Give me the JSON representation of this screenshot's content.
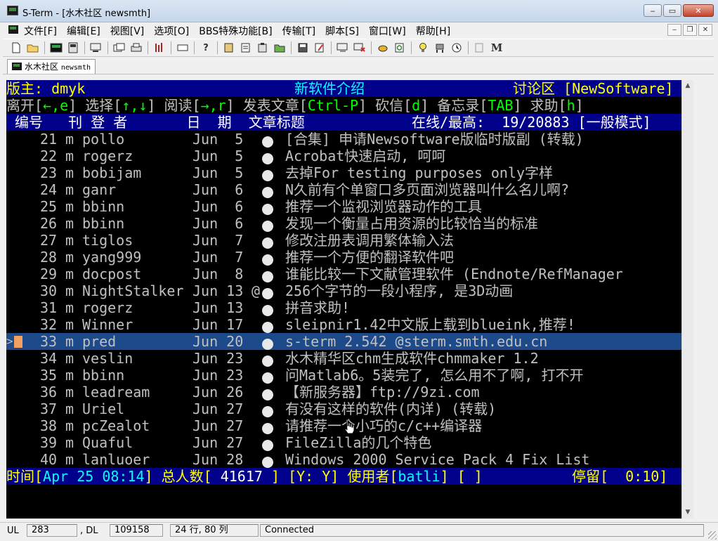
{
  "window": {
    "title": "S-Term - [水木社区 newsmth]",
    "minimize": "‒",
    "restore": "▭",
    "close": "✕"
  },
  "menu": {
    "items": [
      "文件[F]",
      "编辑[E]",
      "视图[V]",
      "选项[O]",
      "BBS特殊功能[B]",
      "传输[T]",
      "脚本[S]",
      "窗口[W]",
      "帮助[H]"
    ],
    "mdi_minimize": "‒",
    "mdi_restore": "❐",
    "mdi_close": "✕"
  },
  "tab": {
    "label": "水木社区",
    "host": "newsmth"
  },
  "terminal": {
    "header": {
      "moderator": "版主: dmyk",
      "board_title": "新软件介绍",
      "board_name": "讨论区 [NewSoftware]"
    },
    "help_line": {
      "leave": "离开[",
      "leave_key": "←,e",
      "select": "] 选择[",
      "select_key": "↑,↓",
      "read": "] 阅读[",
      "read_key": "→,r",
      "post": "] 发表文章[",
      "post_key": "Ctrl-P",
      "delete": "] 砍信[",
      "delete_key": "d",
      "memo": "] 备忘录[",
      "memo_key": "TAB",
      "help": "] 求助[",
      "help_key": "h",
      "end": "]"
    },
    "columns": {
      "left": " 编号   刊 登 者       日  期  文章标题",
      "right": "在线/最高:  19/20883 [一般模式]"
    },
    "rows": [
      {
        "num": "21",
        "flag": "m",
        "author": "pollo",
        "date": "Jun  5",
        "mark": " ",
        "title": "[合集] 申请Newsoftware版临时版副 (转载)"
      },
      {
        "num": "22",
        "flag": "m",
        "author": "rogerz",
        "date": "Jun  5",
        "mark": " ",
        "title": "Acrobat快速启动, 呵呵"
      },
      {
        "num": "23",
        "flag": "m",
        "author": "bobijam",
        "date": "Jun  5",
        "mark": " ",
        "title": "去掉For testing purposes only字样"
      },
      {
        "num": "24",
        "flag": "m",
        "author": "ganr",
        "date": "Jun  6",
        "mark": " ",
        "title": "N久前有个单窗口多页面浏览器叫什么名儿啊?"
      },
      {
        "num": "25",
        "flag": "m",
        "author": "bbinn",
        "date": "Jun  6",
        "mark": " ",
        "title": "推荐一个监视浏览器动作的工具"
      },
      {
        "num": "26",
        "flag": "m",
        "author": "bbinn",
        "date": "Jun  6",
        "mark": " ",
        "title": "发现一个衡量占用资源的比较恰当的标准"
      },
      {
        "num": "27",
        "flag": "m",
        "author": "tiglos",
        "date": "Jun  7",
        "mark": " ",
        "title": "修改注册表调用繁体输入法"
      },
      {
        "num": "28",
        "flag": "m",
        "author": "yang999",
        "date": "Jun  7",
        "mark": " ",
        "title": "推荐一个方便的翻译软件吧"
      },
      {
        "num": "29",
        "flag": "m",
        "author": "docpost",
        "date": "Jun  8",
        "mark": " ",
        "title": "谁能比较一下文献管理软件 (Endnote/RefManager"
      },
      {
        "num": "30",
        "flag": "m",
        "author": "NightStalker",
        "date": "Jun 13",
        "mark": "@",
        "title": "256个字节的一段小程序, 是3D动画"
      },
      {
        "num": "31",
        "flag": "m",
        "author": "rogerz",
        "date": "Jun 13",
        "mark": " ",
        "title": "拼音求助!"
      },
      {
        "num": "32",
        "flag": "m",
        "author": "Winner",
        "date": "Jun 17",
        "mark": " ",
        "title": "sleipnir1.42中文版上载到blueink,推荐!"
      },
      {
        "num": "33",
        "flag": "m",
        "author": "pred",
        "date": "Jun 20",
        "mark": " ",
        "title": "s-term 2.542 @sterm.smth.edu.cn"
      },
      {
        "num": "34",
        "flag": "m",
        "author": "veslin",
        "date": "Jun 23",
        "mark": " ",
        "title": "水木精华区chm生成软件chmmaker 1.2"
      },
      {
        "num": "35",
        "flag": "m",
        "author": "bbinn",
        "date": "Jun 23",
        "mark": " ",
        "title": "问Matlab6。5装完了, 怎么用不了啊, 打不开"
      },
      {
        "num": "36",
        "flag": "m",
        "author": "leadream",
        "date": "Jun 26",
        "mark": " ",
        "title": "【新服务器】ftp://9zi.com"
      },
      {
        "num": "37",
        "flag": "m",
        "author": "Uriel",
        "date": "Jun 27",
        "mark": " ",
        "title": "有没有这样的软件(内详) (转载)"
      },
      {
        "num": "38",
        "flag": "m",
        "author": "pcZealot",
        "date": "Jun 27",
        "mark": " ",
        "title": "请推荐一个小巧的c/c++编译器"
      },
      {
        "num": "39",
        "flag": "m",
        "author": "Quaful",
        "date": "Jun 27",
        "mark": " ",
        "title": "FileZilla的几个特色"
      },
      {
        "num": "40",
        "flag": "m",
        "author": "lanluoer",
        "date": "Jun 28",
        "mark": " ",
        "title": "Windows 2000 Service Pack 4 Fix List"
      }
    ],
    "selected_row": 12,
    "footer": {
      "time_label": "时间[",
      "time": "Apr 25 08:14",
      "total_label": "] 总人数[ ",
      "total": "41617",
      "yy_label": " ] [Y: Y] 使用者[",
      "user": "batli",
      "after_user": "] [ ]",
      "idle_label": "停留[  0:10]"
    }
  },
  "statusbar": {
    "ul_label": "UL",
    "ul_value": "283",
    "dl_label": ",  DL",
    "dl_value": "109158",
    "position": "24 行, 80 列",
    "status": "Connected"
  },
  "colors": {
    "terminal_bg": "#000000",
    "header_bg": "#00008b",
    "selection": "#1c4a8a",
    "yellow": "#ffff00",
    "cyan": "#00ffff"
  },
  "icons": [
    "new-file-icon",
    "open-folder-icon",
    "green-screen-icon",
    "address-book-icon",
    "disconnect-icon",
    "copy-icon",
    "print-icon",
    "equalizer-icon",
    "window-icon",
    "help-icon",
    "paste-icon",
    "copy-text-icon",
    "clipboard-icon",
    "folder-icon",
    "save-icon",
    "edit-icon",
    "send-icon",
    "delete-icon",
    "bee-icon",
    "refresh-icon",
    "lightbulb-icon",
    "robot-icon",
    "clock-icon",
    "document-icon",
    "m-icon"
  ]
}
